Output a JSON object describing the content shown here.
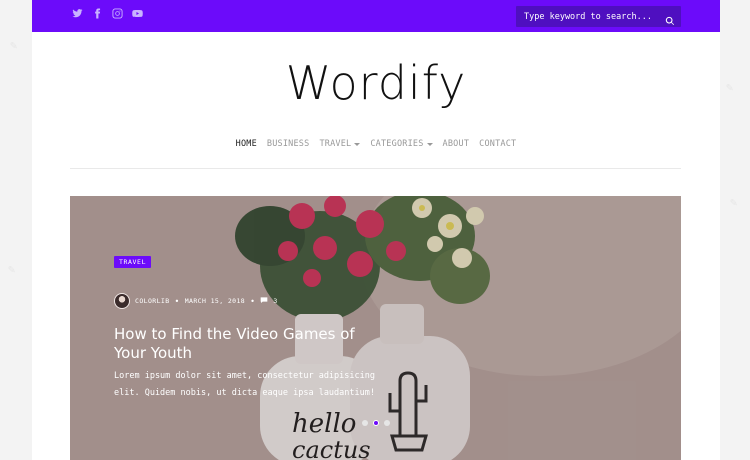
{
  "site": {
    "logo": "Wordify",
    "accent": "#6c0bfa"
  },
  "topbar": {
    "socials": [
      "twitter-icon",
      "facebook-icon",
      "instagram-icon",
      "youtube-icon"
    ],
    "search_placeholder": "Type keyword to search..."
  },
  "nav": {
    "items": [
      {
        "label": "HOME",
        "active": true,
        "dropdown": false
      },
      {
        "label": "BUSINESS",
        "active": false,
        "dropdown": false
      },
      {
        "label": "TRAVEL",
        "active": false,
        "dropdown": true
      },
      {
        "label": "CATEGORIES",
        "active": false,
        "dropdown": true
      },
      {
        "label": "ABOUT",
        "active": false,
        "dropdown": false
      },
      {
        "label": "CONTACT",
        "active": false,
        "dropdown": false
      }
    ]
  },
  "hero": {
    "tag": "TRAVEL",
    "author": "COLORLIB",
    "separator": "•",
    "date": "MARCH 15, 2018",
    "comments": "3",
    "title": "How to Find the Video Games of Your Youth",
    "excerpt": "Lorem ipsum dolor sit amet, consectetur adipisicing elit. Quidem nobis, ut dicta eaque ipsa laudantium!",
    "vase_text": "hello cactus",
    "slides": 3,
    "active_slide": 2
  }
}
